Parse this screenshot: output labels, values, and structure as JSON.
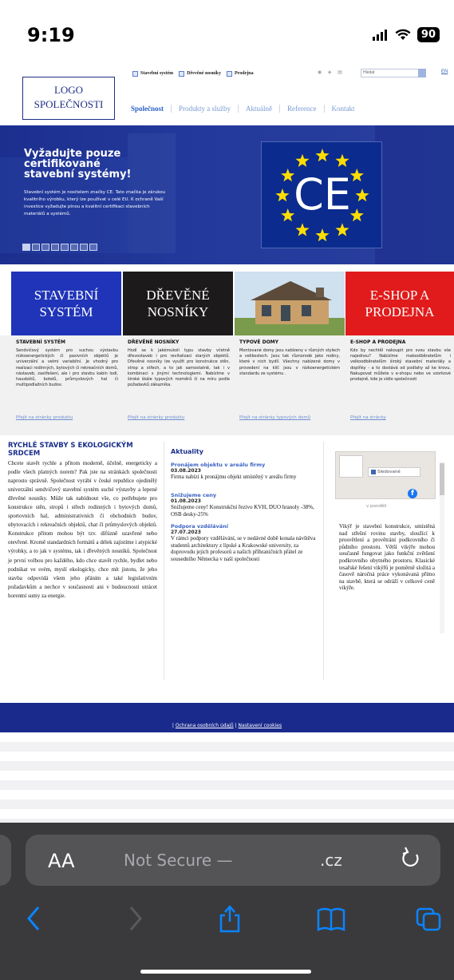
{
  "status": {
    "time": "9:19",
    "battery": "90"
  },
  "site": {
    "logo_line1": "LOGO",
    "logo_line2": "SPOLEČNOSTI",
    "topbar_links": [
      "Stavební systém",
      "Dřevěné nosníky",
      "Prodejna"
    ],
    "search_placeholder": "Hledat",
    "lang": "EN",
    "nav": [
      "Společnost",
      "Produkty a služby",
      "Aktuálně",
      "Reference",
      "Kontakt"
    ]
  },
  "hero": {
    "title": "Vyžadujte pouze certifikované stavební systémy!",
    "text": "Stavební systém je nositelem značky CE. Tato značka je zárukou kvalitního výrobku, který lze používat v celé EU. K ochraně Vaší investice vyžadujte plnou a kvalitní certifikaci stavebních materiálů a systémů."
  },
  "tiles": [
    {
      "banner": "STAVEBNÍ SYSTÉM",
      "heading": "STAVEBNÍ SYSTÉM",
      "text": "Sendvičový systém pro suchou výstavbu nízkoenergetických či pasivních objektů je univerzální a velmi variabilní. Je vhodný pro realizaci rodinných, bytových či rekreačních domů, nástaveb, zastřešení, ale i pro stavbu kabin lodí, hausbótů, botelů, průmyslových hal či multipodlažních budov.",
      "link": "Přejít na stránky produktu"
    },
    {
      "banner": "DŘEVĚNÉ NOSNÍKY",
      "heading": "DŘEVĚNÉ NOSNÍKY",
      "text": "Hodí se k jakémukoli typu stavby včetně dřevostaveb i pro revitalizaci starých objektů. Dřevěné nosníky lze využít pro konstrukce stěn, strop a střech, a to jak samostatně, tak i v kombinaci s jinými technologiemi. Nabízíme v široké škále typových rozměrů či na míru podle požadavků zákazníka.",
      "link": "Přejít na stránky produktu"
    },
    {
      "banner": "",
      "heading": "TYPOVÉ DOMY",
      "text": "Montované domy jsou nabízeny v různých stylech a velikostech. Jsou tak různorodé jako rodiny, které v nich bydlí. Všechny nabízené domy v provedení na klíč jsou v nízkoenergetickém standardu ze systému .",
      "link": "Přejít na stránky typových domů"
    },
    {
      "banner": "E-SHOP A PRODEJNA",
      "heading": "E-SHOP A PRODEJNA",
      "text": "Kdo by nechtěl nakoupit pro svou stavbu vše najednou? Nabízíme maloodběratelům i velkoodběratelům široký stavební materiály a doplňky - a to dostává od podlahy až ke krovu. Nakupovat můžete v e-shopu nebo ve vzorkové prodejně, kde je sídlo společnosti",
      "link": "Přejít na stránky"
    }
  ],
  "left_col": {
    "title": "RYCHLÉ STAVBY S EKOLOGICKÝM SRDCEM",
    "text": "Chcete stavět rychle a přitom moderně, účelně, energeticky a podle všech platných norem? Pak jste na stránkách společnosti naprosto správně. Společnost vyrábí v české republice ojedinělý univerzální sendvičový stavební systém suché výstavby a lepené dřevěné nosníky. Může tak nabídnout vše, co potřebujete pro konstrukce stěn, stropů i střech rodinných i bytových domů, sportovních hal, administrativních či obchodních budov, ubytovacích i rekreačních objektů, chat či průmyslových objektů. Konstrukce přitom mohou být tzv. difúzně uzavřené nebo otevřené. Kromě standardních formátů a délek zajistíme i atypické výrobky, a to jak v systému, tak i dřevěných nosníků. Společnost je první volbou pro každého, kdo chce stavět rychle, bydlet nebo podnikat ve svém, myslí ekologicky, chce mít jistotu, že jeho stavba odpovídá všem jeho přáním a také legislativním požadavkům a nechce v současnosti ani v budoucnosti utrácet horentní sumy za energie."
  },
  "news": {
    "title": "Aktuality",
    "items": [
      {
        "heading": "Pronájem objektu v areálu firmy",
        "date": "03.08.2023",
        "text": "Firma nabízí k pronájmu objekt umístěný v areálu firmy"
      },
      {
        "heading": "Snižujeme ceny",
        "date": "01.08.2023",
        "text": "Snižujeme ceny! Konstrukční řezivo KVH, DUO hranoly -38%, OSB desky-25%"
      },
      {
        "heading": "Podpora vzdělávání",
        "date": "27.07.2023",
        "text": "V rámci podpory vzdělávání, se v nedávné době konala návštěva studentů architektury z lipské a Krakowské university, za doprovodu jejich profesorů a našich příhraničních přátel ze sousedního Německa v naší společnosti"
      }
    ]
  },
  "facebook": {
    "follow": "Sledované",
    "date": "v pondělí"
  },
  "right_col": {
    "text": "Vikýř je stavební konstrukce, umístěná nad střešní rovinu stavby, sloužící k prosvětlení a provětrání podkrovního či půdního prostoru. Větší vikýře mohou současně fungovat jako funkční zvětšení podkrovního obytného prostoru. Klasické tesařské řešení vikýřů je poměrně složitá a časově náročná práce vykonávaná přímo na stavbě, která se odráží v celkové ceně vikýře."
  },
  "footer": {
    "link1": "Ochrana osobních údajů",
    "link2": "Nastavení cookies"
  },
  "browser": {
    "aa": "AA",
    "url_prefix": "Not Secure —",
    "url_tld": ".cz"
  },
  "colors": {
    "brand_blue": "#1f2f85",
    "tile_red": "#e11b1b",
    "tile_black": "#1c1a1a",
    "tile_blue": "#1f34b8"
  }
}
